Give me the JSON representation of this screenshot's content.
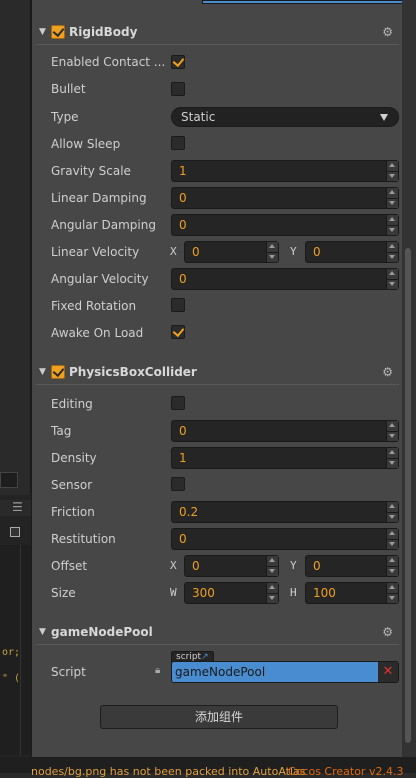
{
  "rigidbody": {
    "title": "RigidBody",
    "enabled_contact_label": "Enabled Contact ...",
    "bullet_label": "Bullet",
    "type_label": "Type",
    "type_value": "Static",
    "allow_sleep_label": "Allow Sleep",
    "gravity_scale_label": "Gravity Scale",
    "gravity_scale_value": "1",
    "linear_damping_label": "Linear Damping",
    "linear_damping_value": "0",
    "angular_damping_label": "Angular Damping",
    "angular_damping_value": "0",
    "linear_velocity_label": "Linear Velocity",
    "linear_velocity_x_axis": "X",
    "linear_velocity_x": "0",
    "linear_velocity_y_axis": "Y",
    "linear_velocity_y": "0",
    "angular_velocity_label": "Angular Velocity",
    "angular_velocity_value": "0",
    "fixed_rotation_label": "Fixed Rotation",
    "awake_on_load_label": "Awake On Load"
  },
  "box_collider": {
    "title": "PhysicsBoxCollider",
    "editing_label": "Editing",
    "tag_label": "Tag",
    "tag_value": "0",
    "density_label": "Density",
    "density_value": "1",
    "sensor_label": "Sensor",
    "friction_label": "Friction",
    "friction_value": "0.2",
    "restitution_label": "Restitution",
    "restitution_value": "0",
    "offset_label": "Offset",
    "offset_x_axis": "X",
    "offset_x": "0",
    "offset_y_axis": "Y",
    "offset_y": "0",
    "size_label": "Size",
    "size_w_axis": "W",
    "size_w": "300",
    "size_h_axis": "H",
    "size_h": "100"
  },
  "game_node_pool": {
    "title": "gameNodePool",
    "script_label": "Script",
    "script_tag": "script",
    "script_value": "gameNodePool"
  },
  "add_component_label": "添加组件",
  "status": {
    "message": "nodes/bg.png has not been packed into AutoAtlas",
    "version": "Cocos Creator v2.4.3"
  },
  "left_strip": {
    "code_line_1": "or;",
    "code_line_2": "\" ("
  },
  "colors": {
    "accent": "#f0a020",
    "selection": "#4a8cd0",
    "panel_bg": "#474747",
    "remove": "#e03030"
  }
}
